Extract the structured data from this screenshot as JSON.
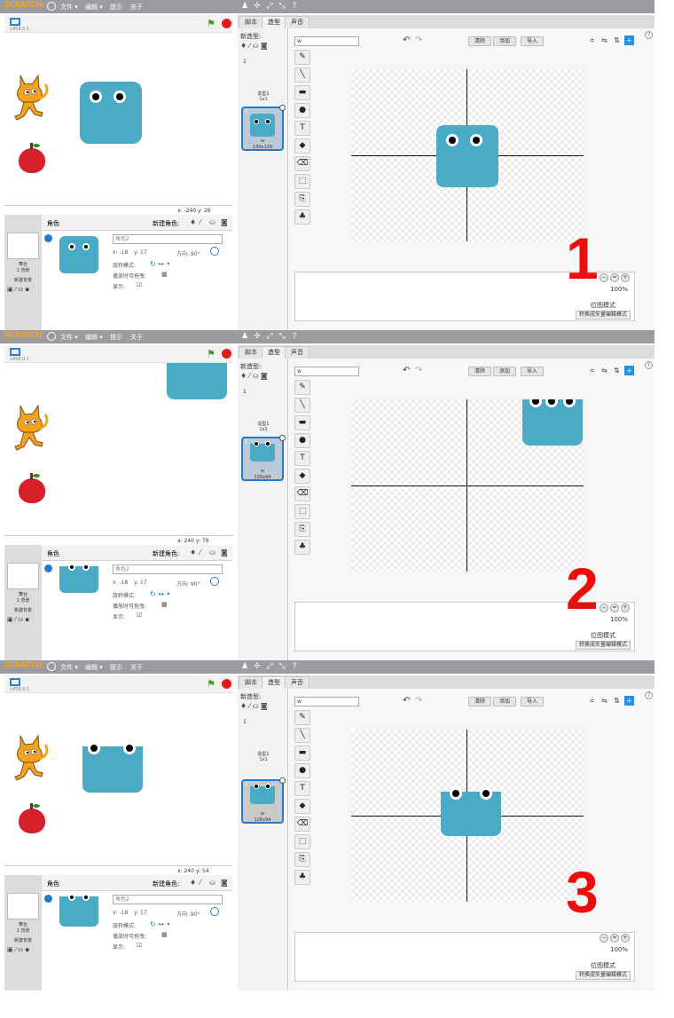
{
  "menu": {
    "logo": "SCRATCH",
    "file": "文件 ▾",
    "edit": "编辑 ▾",
    "tips": "提示",
    "about": "关于"
  },
  "stage": {
    "version": "v458.0.1"
  },
  "sprites_panel": {
    "title": "角色",
    "new_sprite": "新建角色:",
    "stage_label": "舞台",
    "backdrops": "1 背景",
    "new_backdrop": "新建背景",
    "rotation_label": "旋转模式:",
    "draggable_label": "播放时可拖曳:",
    "show_label": "显示:",
    "name_value": "角色2",
    "dir_label": "方向: 90°"
  },
  "tabs": {
    "scripts": "脚本",
    "costumes": "造型",
    "sounds": "声音"
  },
  "editor": {
    "new_costume": "新造型:",
    "costume_name_input": "w",
    "clear": "清除",
    "add": "添加",
    "import": "导入",
    "bitmap_mode": "位图模式",
    "convert_vector": "转换成矢量编辑模式",
    "zoom": "100%",
    "costume1_name": "造型1",
    "costume1_size": "1x1",
    "costume2_name": "w"
  },
  "tool_icons": [
    "brush-icon",
    "line-icon",
    "rectangle-icon",
    "ellipse-icon",
    "text-icon",
    "fill-icon",
    "eraser-icon",
    "select-icon",
    "select-duplicate-icon",
    "stamp-icon"
  ],
  "panels": [
    {
      "number": "1",
      "coords": "x: -240  y: 26",
      "sprite_x": "x: -18",
      "sprite_y": "y: 17",
      "costume2_size": "130x129"
    },
    {
      "number": "2",
      "coords": "x: 240  y: 79",
      "sprite_x": "x: -18",
      "sprite_y": "y: 17",
      "costume2_size": "126x94"
    },
    {
      "number": "3",
      "coords": "x: 240  y: 54",
      "sprite_x": "x: -18",
      "sprite_y": "y: 17",
      "costume2_size": "126x94"
    }
  ],
  "colors": {
    "sprite": "#4aabc6",
    "accent": "#1f7bd1",
    "annotation": "#ee0d0d"
  }
}
